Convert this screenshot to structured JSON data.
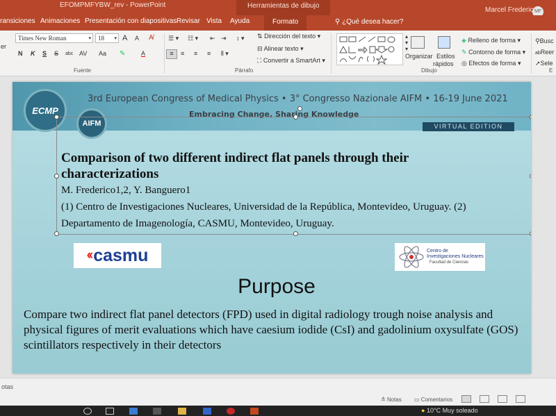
{
  "window": {
    "doc_name": "EFOMPMFYBW_rev  -  PowerPoint",
    "contextual_tab": "Herramientas de dibujo",
    "user_name": "Marcel Frederico",
    "user_initials": "MF"
  },
  "tabs": [
    {
      "label": "ransiciones"
    },
    {
      "label": "Animaciones"
    },
    {
      "label": "Presentación con diapositivas"
    },
    {
      "label": "Revisar"
    },
    {
      "label": "Vista"
    },
    {
      "label": "Ayuda"
    },
    {
      "label": "Formato"
    }
  ],
  "tell_me": "¿Qué desea hacer?",
  "ribbon": {
    "font_name": "Times New Roman",
    "font_size": "18",
    "grow": "A",
    "shrink": "A",
    "bold": "N",
    "italic": "K",
    "underline": "S",
    "strike": "S",
    "shadow": "abc",
    "spacing": "AV",
    "case": "Aa",
    "font_color": "A",
    "group_font": "Fuente",
    "group_paragraph": "Párrafo",
    "group_drawing": "Dibujo",
    "text_direction": "Dirección del texto",
    "align_text": "Alinear texto",
    "smartart": "Convertir a SmartArt",
    "arrange": "Organizar",
    "quick_styles_1": "Estilos",
    "quick_styles_2": "rápidos",
    "shape_fill": "Relleno de forma",
    "shape_outline": "Contorno de forma",
    "shape_effects": "Efectos de forma",
    "find": "Busc",
    "replace": "Reer",
    "select": "Sele",
    "edit_short": "E",
    "left_edge": "er"
  },
  "slide": {
    "conf_title_part1": "3rd European Congress of Medical Physics  •  ",
    "conf_title_part2": "3° Congresso Nazionale AIFM  •  16-19 June 2021",
    "conf_sub": "Embracing Change, Sharing Knowledge",
    "virtual": "VIRTUAL EDITION",
    "ecmp_logo": "ECMP",
    "aifm_logo": "AIFM",
    "paper_title": "Comparison of two different indirect flat panels through their characterizations",
    "authors": "M. Frederico1,2, Y. Banguero1",
    "affil_1": "(1) Centro de Investigaciones Nucleares, Universidad de la República, Montevideo, Uruguay. (2)",
    "affil_2": "Departamento de Imagenología, CASMU, Montevideo, Uruguay.",
    "casmu_mark": "‹‹",
    "casmu_word": "casmu",
    "cin_line1": "Centro de",
    "cin_line2": "Investigaciones Nucleares",
    "cin_line3": "Facultad de Ciencias",
    "purpose_heading": "Purpose",
    "purpose_body": "Compare two indirect flat panel detectors (FPD) used in digital radiology trough noise analysis and physical figures of merit evaluations which have caesium iodide (CsI) and gadolinium oxysulfate (GOS) scintillators respectively in their detectors"
  },
  "status": {
    "notes_label": "otas",
    "notes_btn": "Notas",
    "comments_btn": "Comentarios"
  },
  "taskbar": {
    "weather": "10°C  Muy soleado"
  },
  "colors": {
    "ppt_red": "#b7472a",
    "slide_bg": "#a6d3db",
    "banner": "#6fb1c4",
    "casmu_blue": "#1c3f94",
    "casmu_red": "#e2231a"
  }
}
